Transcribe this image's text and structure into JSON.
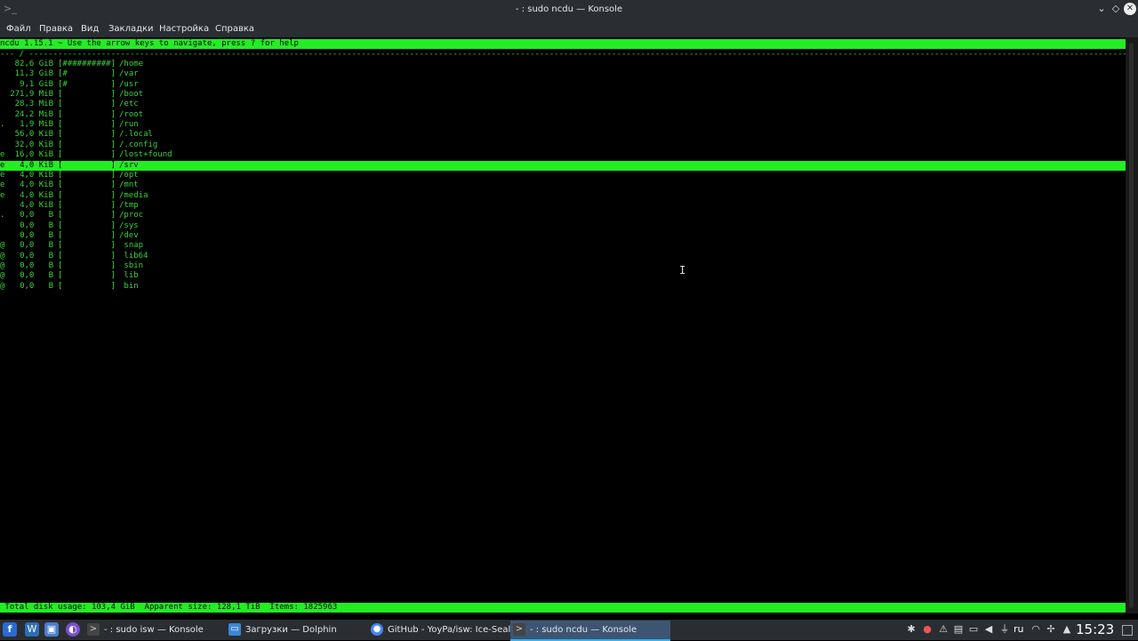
{
  "window": {
    "title": "- : sudo ncdu — Konsole",
    "controls": {
      "minimize": "⌄",
      "maximize": "◇",
      "close": "✕"
    }
  },
  "menu": [
    "Файл",
    "Правка",
    "Вид",
    "Закладки",
    "Настройка",
    "Справка"
  ],
  "ncdu": {
    "header": "ncdu 1.15.1 ~ Use the arrow keys to navigate, press ? for help",
    "path_line": "--- / ----------------------------------------------------------------------------------------------------------------------------------------------------------------------------------------------------------------------------------------------------------------",
    "rows": [
      {
        "flag": " ",
        "size": "82,6 GiB",
        "bar": "[##########]",
        "name": "/home"
      },
      {
        "flag": " ",
        "size": "11,3 GiB",
        "bar": "[#         ]",
        "name": "/var"
      },
      {
        "flag": " ",
        "size": "9,1 GiB",
        "bar": "[#         ]",
        "name": "/usr"
      },
      {
        "flag": " ",
        "size": "271,9 MiB",
        "bar": "[          ]",
        "name": "/boot"
      },
      {
        "flag": " ",
        "size": "28,3 MiB",
        "bar": "[          ]",
        "name": "/etc"
      },
      {
        "flag": " ",
        "size": "24,2 MiB",
        "bar": "[          ]",
        "name": "/root"
      },
      {
        "flag": ".",
        "size": "1,9 MiB",
        "bar": "[          ]",
        "name": "/run"
      },
      {
        "flag": " ",
        "size": "56,0 KiB",
        "bar": "[          ]",
        "name": "/.local"
      },
      {
        "flag": " ",
        "size": "32,0 KiB",
        "bar": "[          ]",
        "name": "/.config"
      },
      {
        "flag": "e",
        "size": "16,0 KiB",
        "bar": "[          ]",
        "name": "/lost+found"
      },
      {
        "flag": "e",
        "size": "4,0 KiB",
        "bar": "[          ]",
        "name": "/srv",
        "selected": true
      },
      {
        "flag": "e",
        "size": "4,0 KiB",
        "bar": "[          ]",
        "name": "/opt"
      },
      {
        "flag": "e",
        "size": "4,0 KiB",
        "bar": "[          ]",
        "name": "/mnt"
      },
      {
        "flag": "e",
        "size": "4,0 KiB",
        "bar": "[          ]",
        "name": "/media"
      },
      {
        "flag": " ",
        "size": "4,0 KiB",
        "bar": "[          ]",
        "name": "/tmp"
      },
      {
        "flag": ".",
        "size": "0,0   B",
        "bar": "[          ]",
        "name": "/proc"
      },
      {
        "flag": " ",
        "size": "0,0   B",
        "bar": "[          ]",
        "name": "/sys"
      },
      {
        "flag": " ",
        "size": "0,0   B",
        "bar": "[          ]",
        "name": "/dev"
      },
      {
        "flag": "@",
        "size": "0,0   B",
        "bar": "[          ]",
        "name": " snap"
      },
      {
        "flag": "@",
        "size": "0,0   B",
        "bar": "[          ]",
        "name": " lib64"
      },
      {
        "flag": "@",
        "size": "0,0   B",
        "bar": "[          ]",
        "name": " sbin"
      },
      {
        "flag": "@",
        "size": "0,0   B",
        "bar": "[          ]",
        "name": " lib"
      },
      {
        "flag": "@",
        "size": "0,0   B",
        "bar": "[          ]",
        "name": " bin"
      }
    ],
    "status": " Total disk usage: 103,4 GiB  Apparent size: 128,1 TiB  Items: 1825963"
  },
  "taskbar": {
    "tasks": [
      {
        "label": "- : sudo isw — Konsole",
        "icon": "terminal-icon",
        "active": false
      },
      {
        "label": "Загрузки — Dolphin",
        "icon": "folder-icon",
        "active": false
      },
      {
        "label": "GitHub - YoyPa/isw: Ice-Seale...",
        "icon": "chrome-icon",
        "active": false
      },
      {
        "label": "- : sudo ncdu — Konsole",
        "icon": "terminal-icon",
        "active": true
      }
    ],
    "keyboard_layout": "ru",
    "clock": "15:23"
  }
}
